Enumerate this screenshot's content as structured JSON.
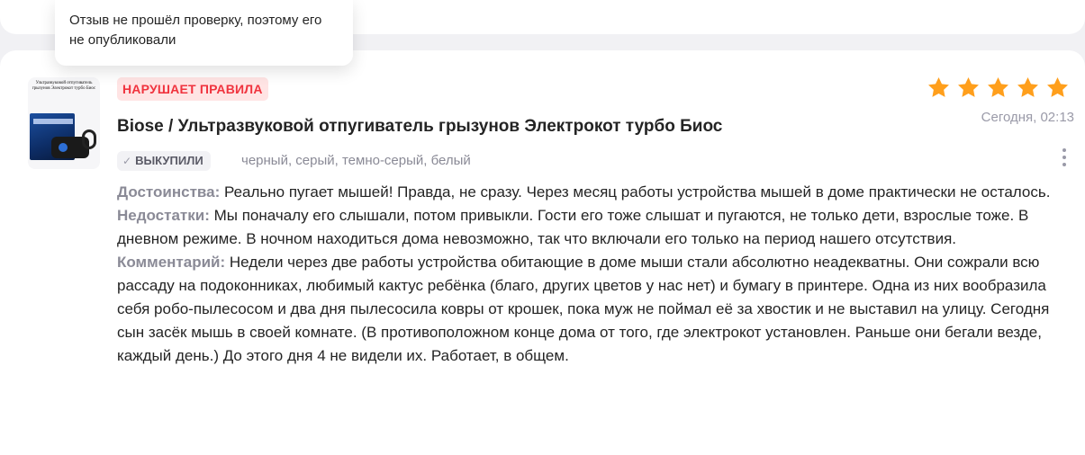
{
  "tooltip": {
    "text": "Отзыв не прошёл проверку, поэтому его не опубликовали"
  },
  "review": {
    "status_badge": "НАРУШАЕТ ПРАВИЛА",
    "product_title": "Biose / Ультразвуковой отпугиватель грызунов Электрокот турбо Биос",
    "purchased_label": "ВЫКУПИЛИ",
    "variant": "черный, серый, темно-серый, белый",
    "rating": 5,
    "rating_max": 5,
    "date": "Сегодня, 02:13",
    "pros_label": "Достоинства:",
    "pros_text": "Реально пугает мышей! Правда, не сразу. Через месяц работы устройства мышей в доме практически не осталось.",
    "cons_label": "Недостатки:",
    "cons_text": "Мы поначалу его слышали, потом привыкли. Гости его тоже слышат и пугаются, не только дети, взрослые тоже. В дневном режиме. В ночном находиться дома невозможно, так что включали его только на период нашего отсутствия.",
    "comment_label": "Комментарий:",
    "comment_text": "Недели через две работы устройства обитающие в доме мыши стали абсолютно неадекватны. Они сожрали всю рассаду на подоконниках, любимый кактус ребёнка (благо, других цветов у нас нет) и бумагу в принтере. Одна из них вообразила себя робо-пылесосом и два дня пылесосила ковры от крошек, пока муж не поймал её за хвостик и не выставил на улицу. Сегодня сын засёк мышь в своей комнате. (В противоположном конце дома от того, где электрокот установлен. Раньше они бегали везде, каждый день.) До этого дня 4 не видели их. Работает, в общем."
  },
  "thumbnail": {
    "caption": "Ультразвуковой отпугиватель грызунов Электрокот турбо Биос",
    "box_text": "ОТПУГИВАТЕЛЬ"
  },
  "icons": {
    "star": "star-icon",
    "check": "check-icon",
    "more": "more-vertical-icon"
  },
  "colors": {
    "star": "#ff9f1c",
    "violation_bg": "#ffe4e4",
    "violation_text": "#f0333e",
    "muted_label": "#8a8a96"
  }
}
